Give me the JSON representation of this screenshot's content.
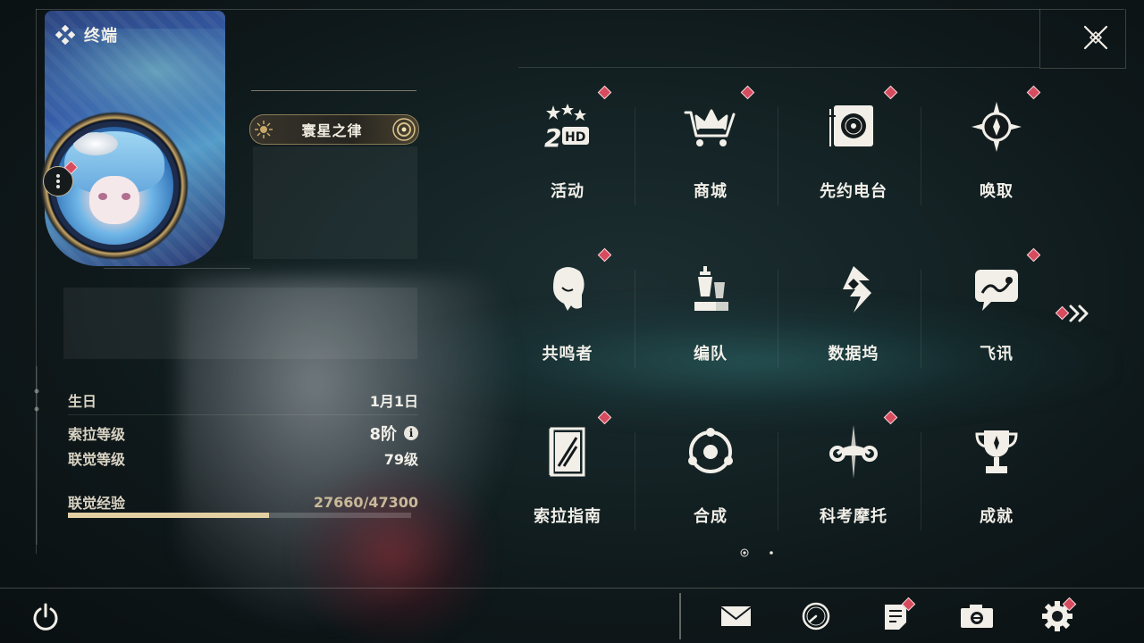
{
  "header": {
    "title": "终端"
  },
  "profile": {
    "nickname": "寰星之律",
    "stats": [
      {
        "label": "生日",
        "value": "1月1日"
      },
      {
        "label": "索拉等级",
        "value": "8阶"
      },
      {
        "label": "联觉等级",
        "value": "79级"
      }
    ],
    "exp": {
      "label": "联觉经验",
      "value": "27660/47300",
      "current": 27660,
      "max": 47300
    }
  },
  "menu": {
    "page": 1,
    "pages": 2,
    "items": [
      {
        "label": "活动",
        "icon": "activity-2hd-icon",
        "badge": true
      },
      {
        "label": "商城",
        "icon": "shop-crown-cart-icon",
        "badge": true
      },
      {
        "label": "先约电台",
        "icon": "radio-turntable-icon",
        "badge": true
      },
      {
        "label": "唤取",
        "icon": "summon-star-icon",
        "badge": true
      },
      {
        "label": "共鸣者",
        "icon": "resonator-portrait-icon",
        "badge": true
      },
      {
        "label": "编队",
        "icon": "team-chess-icon",
        "badge": false
      },
      {
        "label": "数据坞",
        "icon": "data-bank-icon",
        "badge": false
      },
      {
        "label": "飞讯",
        "icon": "chat-bubble-icon",
        "badge": true
      },
      {
        "label": "索拉指南",
        "icon": "guide-book-icon",
        "badge": true
      },
      {
        "label": "合成",
        "icon": "synthesis-orbit-icon",
        "badge": false
      },
      {
        "label": "科考摩托",
        "icon": "motorcycle-icon",
        "badge": true
      },
      {
        "label": "成就",
        "icon": "trophy-icon",
        "badge": false
      }
    ]
  },
  "colors": {
    "badge": "#d64b5e",
    "accent": "#e2cfa2",
    "text": "#f1efe8"
  }
}
